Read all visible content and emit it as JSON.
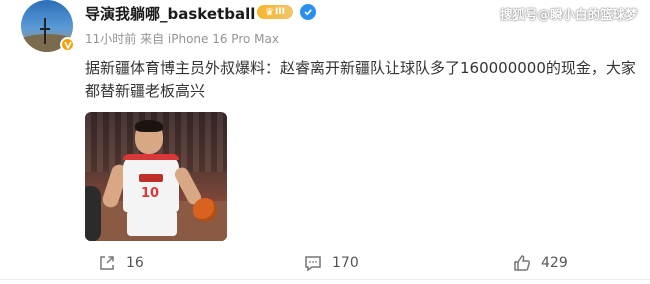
{
  "post": {
    "username": "导演我躺哪_basketball",
    "level_badge": "III",
    "meta": "11小时前 来自 iPhone 16 Pro Max",
    "content": "据新疆体育博主员外叔爆料：赵睿离开新疆队让球队多了160000000的现金，大家都替新疆老板高兴",
    "image_alt": "球员持球照片",
    "jersey_number": "10"
  },
  "watermark": "搜狐号@瞬小白的篮球梦",
  "actions": {
    "share_count": "16",
    "comment_count": "170",
    "like_count": "429"
  },
  "colors": {
    "accent_verified": "#2a8ef0",
    "badge_gold": "#f3a20a",
    "meta_gray": "#939393"
  }
}
